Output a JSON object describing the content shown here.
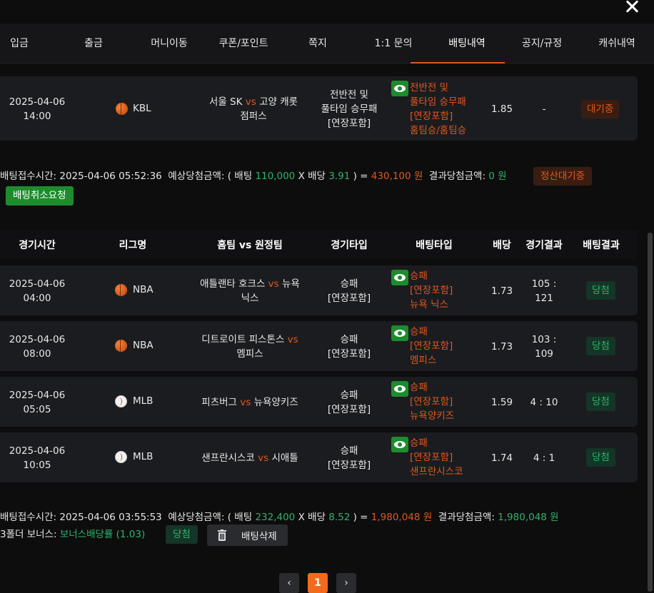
{
  "nav": {
    "tabs": [
      "입금",
      "출금",
      "머니이동",
      "쿠폰/포인트",
      "쪽지",
      "1:1 문의",
      "배팅내역",
      "공지/규정",
      "캐쉬내역"
    ],
    "active_index": 6
  },
  "bet1": {
    "row": {
      "date": "2025-04-06",
      "time": "14:00",
      "sport_icon": "basketball-icon",
      "league": "KBL",
      "home": "서울 SK",
      "vs": "vs",
      "away_line1": "고양 캐롯",
      "away_line2": "점퍼스",
      "game_type_lines": [
        "전반전 및",
        "풀타임 승무패",
        "[연장포함]"
      ],
      "bet_type_lines": [
        "전반전 및",
        "풀타임 승무패",
        "[연장포함]",
        "홈팀승/홈팀승"
      ],
      "odds": "1.85",
      "result": "-",
      "status": "대기중"
    },
    "summary": {
      "time_label": "배팅접수시간:",
      "time_value": "2025-04-06 05:52:36",
      "expected_label": "예상당첨금액:",
      "open": "( 배팅",
      "stake": "110,000",
      "x": "X 배당",
      "odds": "3.91",
      "close": ") =",
      "expected": "430,100 원",
      "result_label": "결과당첨금액:",
      "result_value": "0 원",
      "status": "정산대기중"
    },
    "cancel_button": "배팅취소요청"
  },
  "table_header": [
    "경기시간",
    "리그명",
    "홈팀 vs 원정팀",
    "경기타입",
    "배팅타입",
    "배당",
    "경기결과",
    "배팅결과"
  ],
  "bet2": {
    "rows": [
      {
        "date": "2025-04-06",
        "time": "04:00",
        "sport_icon": "basketball-icon",
        "league": "NBA",
        "home": "애틀랜타 호크스",
        "vs": "vs",
        "away_line1": "뉴욕",
        "away_line2": "닉스",
        "game_type_lines": [
          "승패",
          "[연장포함]"
        ],
        "bet_type_lines": [
          "승패",
          "[연장포함]",
          "뉴욕 닉스"
        ],
        "odds": "1.73",
        "result_line1": "105 :",
        "result_line2": "121",
        "status": "당첨"
      },
      {
        "date": "2025-04-06",
        "time": "08:00",
        "sport_icon": "basketball-icon",
        "league": "NBA",
        "home": "디트로이트 피스톤스",
        "vs": "vs",
        "away_line1": "",
        "away_line2": "멤피스",
        "game_type_lines": [
          "승패",
          "[연장포함]"
        ],
        "bet_type_lines": [
          "승패",
          "[연장포함]",
          "멤피스"
        ],
        "odds": "1.73",
        "result_line1": "103 :",
        "result_line2": "109",
        "status": "당첨"
      },
      {
        "date": "2025-04-06",
        "time": "05:05",
        "sport_icon": "baseball-icon",
        "league": "MLB",
        "home": "피츠버그",
        "vs": "vs",
        "away_line1": "뉴욕양키즈",
        "away_line2": "",
        "game_type_lines": [
          "승패",
          "[연장포함]"
        ],
        "bet_type_lines": [
          "승패",
          "[연장포함]",
          "뉴욕양키즈"
        ],
        "odds": "1.59",
        "result_line1": "4 : 10",
        "result_line2": "",
        "status": "당첨"
      },
      {
        "date": "2025-04-06",
        "time": "10:05",
        "sport_icon": "baseball-icon",
        "league": "MLB",
        "home": "샌프란시스코",
        "vs": "vs",
        "away_line1": "시애틀",
        "away_line2": "",
        "game_type_lines": [
          "승패",
          "[연장포함]"
        ],
        "bet_type_lines": [
          "승패",
          "[연장포함]",
          "샌프란시스코"
        ],
        "odds": "1.74",
        "result_line1": "4 : 1",
        "result_line2": "",
        "status": "당첨"
      }
    ],
    "summary": {
      "time_label": "배팅접수시간:",
      "time_value": "2025-04-06 03:55:53",
      "expected_label": "예상당첨금액:",
      "open": "( 배팅",
      "stake": "232,400",
      "x": "X 배당",
      "odds": "8.52",
      "close": ") =",
      "expected": "1,980,048 원",
      "result_label": "결과당첨금액:",
      "result_value": "1,980,048 원"
    },
    "bonus_label": "3폴더 보너스:",
    "bonus_value": "보너스배당률 (1.03)",
    "status": "당첨",
    "delete_button": "배팅삭제"
  },
  "pagination": {
    "prev": "‹",
    "current": "1",
    "next": "›"
  },
  "colors": {
    "accent": "#e0581d",
    "win": "#2fb36a",
    "button_green": "#1d8c2d"
  }
}
